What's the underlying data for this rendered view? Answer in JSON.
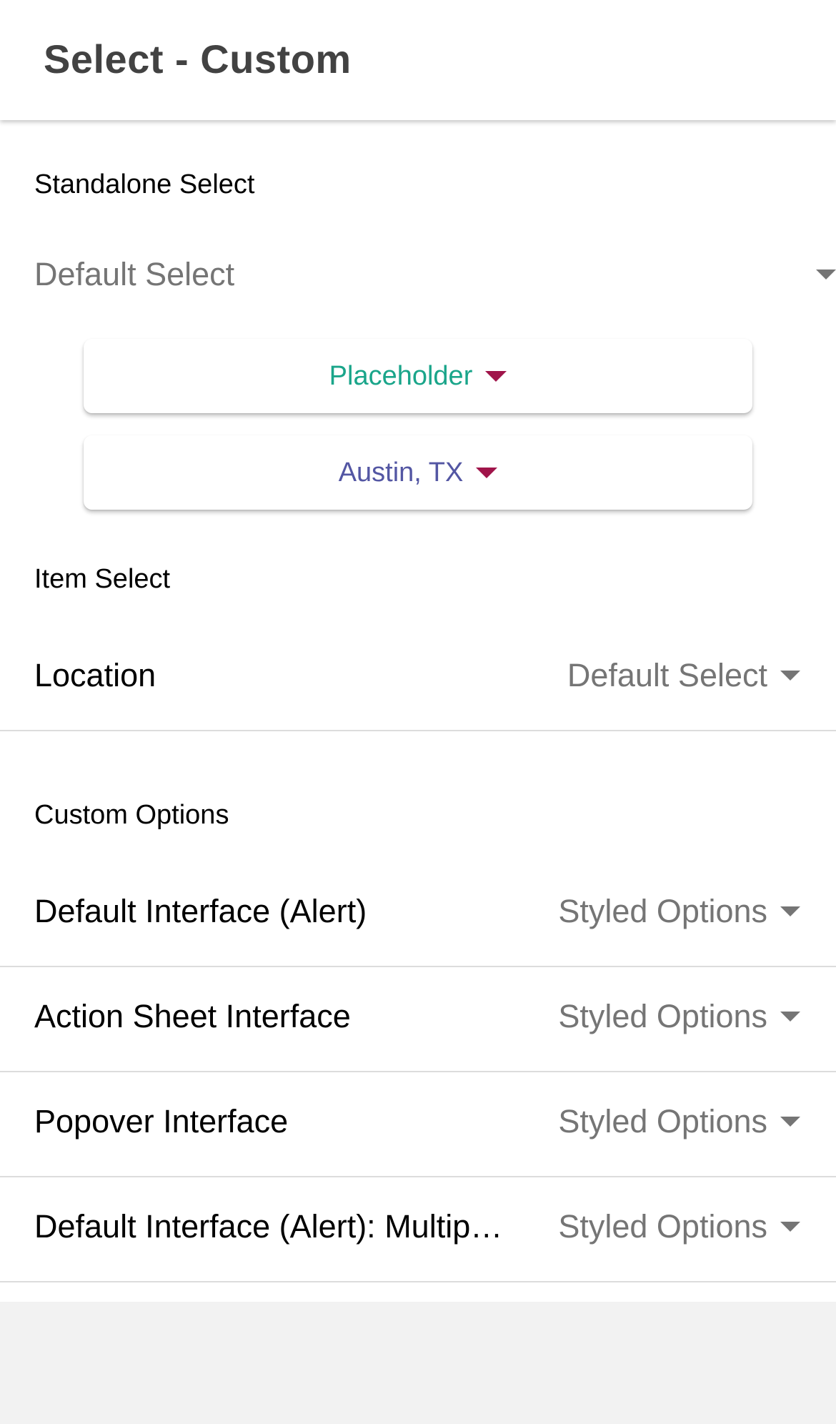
{
  "toolbar": {
    "title": "Select - Custom"
  },
  "standalone_section": {
    "header": "Standalone Select",
    "default_select": {
      "text": "Default Select"
    },
    "placeholder_select": {
      "text": "Placeholder",
      "text_color": "#1aa58a",
      "caret_color": "#a0144a"
    },
    "location_select": {
      "text": "Austin, TX",
      "text_color": "#5356a3",
      "caret_color": "#a0144a"
    }
  },
  "item_section": {
    "header": "Item Select",
    "rows": [
      {
        "label": "Location",
        "value": "Default Select"
      }
    ]
  },
  "custom_section": {
    "header": "Custom Options",
    "rows": [
      {
        "label": "Default Interface (Alert)",
        "value": "Styled Options"
      },
      {
        "label": "Action Sheet Interface",
        "value": "Styled Options"
      },
      {
        "label": "Popover Interface",
        "value": "Styled Options"
      },
      {
        "label": "Default Interface (Alert): Multiple Selection",
        "value": "Styled Options"
      }
    ]
  },
  "colors": {
    "value_text": "#757575",
    "caret": "#757575",
    "divider": "#dcdcdc",
    "toolbar_title": "#424242",
    "background": "#f2f2f2"
  },
  "icons": {
    "dropdown": "caret-down-icon"
  }
}
